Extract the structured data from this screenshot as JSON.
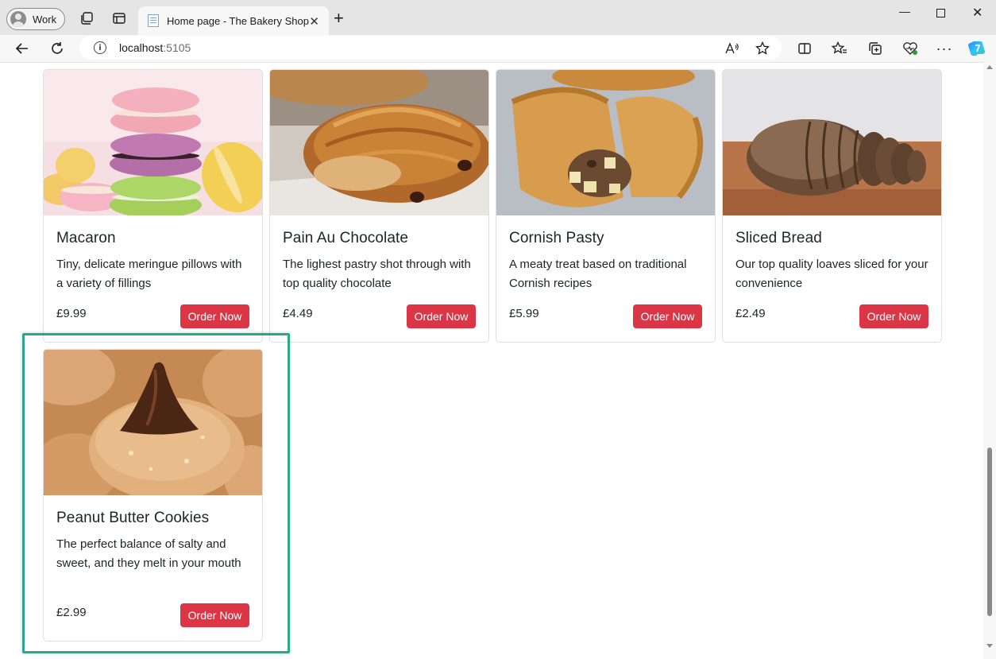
{
  "browser": {
    "profile_label": "Work",
    "tab_title": "Home page - The Bakery Shop",
    "url_host": "localhost",
    "url_port": ":5105",
    "icons": [
      "profile-avatar-icon",
      "workspaces-icon",
      "tab-actions-icon",
      "page-favicon",
      "close-tab-icon",
      "new-tab-icon",
      "minimize-icon",
      "maximize-icon",
      "window-close-icon",
      "back-icon",
      "refresh-icon",
      "site-info-icon",
      "read-aloud-icon",
      "favorite-star-icon",
      "split-screen-icon",
      "favorites-icon",
      "collections-icon",
      "browser-essentials-icon",
      "more-icon",
      "copilot-icon"
    ]
  },
  "products": [
    {
      "name": "Macaron",
      "description": "Tiny, delicate meringue pillows with a variety of fillings",
      "price": "£9.99",
      "button": "Order Now"
    },
    {
      "name": "Pain Au Chocolate",
      "description": "The lighest pastry shot through with top quality chocolate",
      "price": "£4.49",
      "button": "Order Now"
    },
    {
      "name": "Cornish Pasty",
      "description": "A meaty treat based on traditional Cornish recipes",
      "price": "£5.99",
      "button": "Order Now"
    },
    {
      "name": "Sliced Bread",
      "description": "Our top quality loaves sliced for your convenience",
      "price": "£2.49",
      "button": "Order Now"
    },
    {
      "name": "Peanut Butter Cookies",
      "description": "The perfect balance of salty and sweet, and they melt in your mouth",
      "price": "£2.99",
      "button": "Order Now"
    }
  ],
  "colors": {
    "order_button": "#dc3545",
    "highlight_border": "#2ba88a"
  }
}
